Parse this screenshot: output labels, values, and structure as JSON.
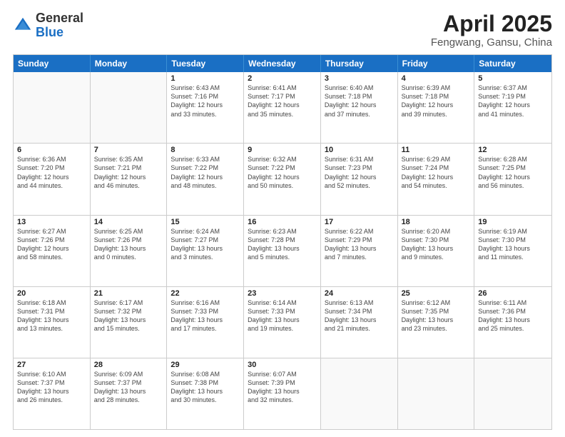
{
  "header": {
    "logo": {
      "general": "General",
      "blue": "Blue"
    },
    "title": "April 2025",
    "subtitle": "Fengwang, Gansu, China"
  },
  "calendar": {
    "days": [
      "Sunday",
      "Monday",
      "Tuesday",
      "Wednesday",
      "Thursday",
      "Friday",
      "Saturday"
    ],
    "rows": [
      [
        {
          "day": "",
          "info": "",
          "empty": true
        },
        {
          "day": "",
          "info": "",
          "empty": true
        },
        {
          "day": "1",
          "info": "Sunrise: 6:43 AM\nSunset: 7:16 PM\nDaylight: 12 hours\nand 33 minutes."
        },
        {
          "day": "2",
          "info": "Sunrise: 6:41 AM\nSunset: 7:17 PM\nDaylight: 12 hours\nand 35 minutes."
        },
        {
          "day": "3",
          "info": "Sunrise: 6:40 AM\nSunset: 7:18 PM\nDaylight: 12 hours\nand 37 minutes."
        },
        {
          "day": "4",
          "info": "Sunrise: 6:39 AM\nSunset: 7:18 PM\nDaylight: 12 hours\nand 39 minutes."
        },
        {
          "day": "5",
          "info": "Sunrise: 6:37 AM\nSunset: 7:19 PM\nDaylight: 12 hours\nand 41 minutes."
        }
      ],
      [
        {
          "day": "6",
          "info": "Sunrise: 6:36 AM\nSunset: 7:20 PM\nDaylight: 12 hours\nand 44 minutes."
        },
        {
          "day": "7",
          "info": "Sunrise: 6:35 AM\nSunset: 7:21 PM\nDaylight: 12 hours\nand 46 minutes."
        },
        {
          "day": "8",
          "info": "Sunrise: 6:33 AM\nSunset: 7:22 PM\nDaylight: 12 hours\nand 48 minutes."
        },
        {
          "day": "9",
          "info": "Sunrise: 6:32 AM\nSunset: 7:22 PM\nDaylight: 12 hours\nand 50 minutes."
        },
        {
          "day": "10",
          "info": "Sunrise: 6:31 AM\nSunset: 7:23 PM\nDaylight: 12 hours\nand 52 minutes."
        },
        {
          "day": "11",
          "info": "Sunrise: 6:29 AM\nSunset: 7:24 PM\nDaylight: 12 hours\nand 54 minutes."
        },
        {
          "day": "12",
          "info": "Sunrise: 6:28 AM\nSunset: 7:25 PM\nDaylight: 12 hours\nand 56 minutes."
        }
      ],
      [
        {
          "day": "13",
          "info": "Sunrise: 6:27 AM\nSunset: 7:26 PM\nDaylight: 12 hours\nand 58 minutes."
        },
        {
          "day": "14",
          "info": "Sunrise: 6:25 AM\nSunset: 7:26 PM\nDaylight: 13 hours\nand 0 minutes."
        },
        {
          "day": "15",
          "info": "Sunrise: 6:24 AM\nSunset: 7:27 PM\nDaylight: 13 hours\nand 3 minutes."
        },
        {
          "day": "16",
          "info": "Sunrise: 6:23 AM\nSunset: 7:28 PM\nDaylight: 13 hours\nand 5 minutes."
        },
        {
          "day": "17",
          "info": "Sunrise: 6:22 AM\nSunset: 7:29 PM\nDaylight: 13 hours\nand 7 minutes."
        },
        {
          "day": "18",
          "info": "Sunrise: 6:20 AM\nSunset: 7:30 PM\nDaylight: 13 hours\nand 9 minutes."
        },
        {
          "day": "19",
          "info": "Sunrise: 6:19 AM\nSunset: 7:30 PM\nDaylight: 13 hours\nand 11 minutes."
        }
      ],
      [
        {
          "day": "20",
          "info": "Sunrise: 6:18 AM\nSunset: 7:31 PM\nDaylight: 13 hours\nand 13 minutes."
        },
        {
          "day": "21",
          "info": "Sunrise: 6:17 AM\nSunset: 7:32 PM\nDaylight: 13 hours\nand 15 minutes."
        },
        {
          "day": "22",
          "info": "Sunrise: 6:16 AM\nSunset: 7:33 PM\nDaylight: 13 hours\nand 17 minutes."
        },
        {
          "day": "23",
          "info": "Sunrise: 6:14 AM\nSunset: 7:33 PM\nDaylight: 13 hours\nand 19 minutes."
        },
        {
          "day": "24",
          "info": "Sunrise: 6:13 AM\nSunset: 7:34 PM\nDaylight: 13 hours\nand 21 minutes."
        },
        {
          "day": "25",
          "info": "Sunrise: 6:12 AM\nSunset: 7:35 PM\nDaylight: 13 hours\nand 23 minutes."
        },
        {
          "day": "26",
          "info": "Sunrise: 6:11 AM\nSunset: 7:36 PM\nDaylight: 13 hours\nand 25 minutes."
        }
      ],
      [
        {
          "day": "27",
          "info": "Sunrise: 6:10 AM\nSunset: 7:37 PM\nDaylight: 13 hours\nand 26 minutes."
        },
        {
          "day": "28",
          "info": "Sunrise: 6:09 AM\nSunset: 7:37 PM\nDaylight: 13 hours\nand 28 minutes."
        },
        {
          "day": "29",
          "info": "Sunrise: 6:08 AM\nSunset: 7:38 PM\nDaylight: 13 hours\nand 30 minutes."
        },
        {
          "day": "30",
          "info": "Sunrise: 6:07 AM\nSunset: 7:39 PM\nDaylight: 13 hours\nand 32 minutes."
        },
        {
          "day": "",
          "info": "",
          "empty": true
        },
        {
          "day": "",
          "info": "",
          "empty": true
        },
        {
          "day": "",
          "info": "",
          "empty": true
        }
      ]
    ]
  }
}
